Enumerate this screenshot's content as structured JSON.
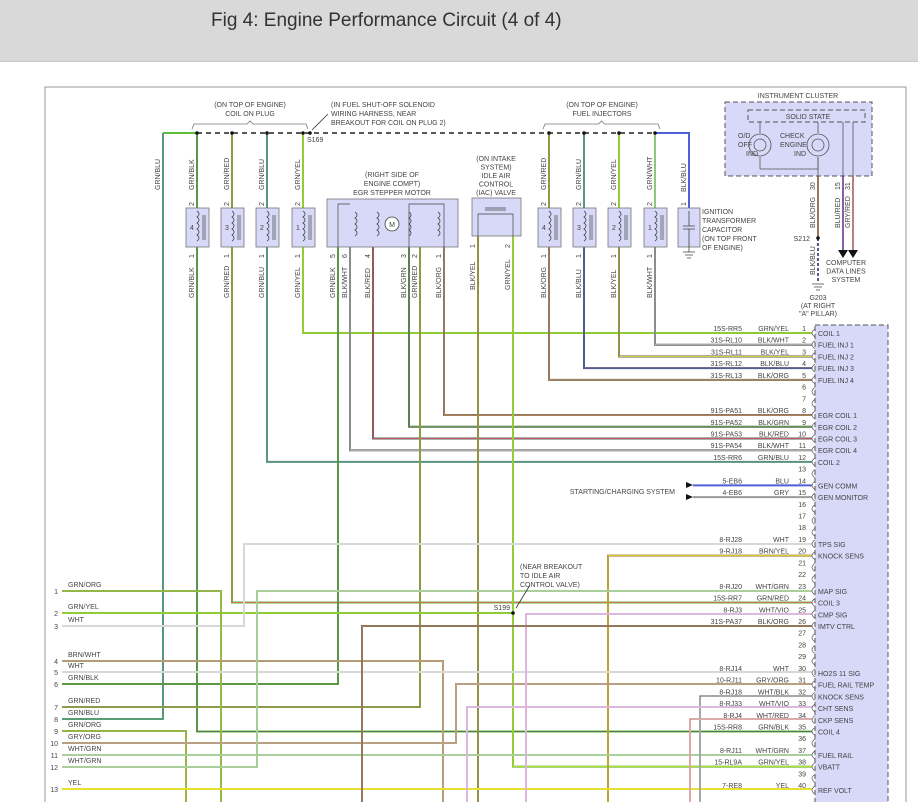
{
  "header": {
    "title": "Fig 4: Engine Performance Circuit (4 of 4)"
  },
  "wire_colors": {
    "GRN": "#5cbf3a",
    "BLK": "#5a5a5a",
    "RED": "#e06060",
    "BLU": "#5060d8",
    "YEL": "#e8e030",
    "WHT": "#d8d8d8",
    "ORG": "#f0a860",
    "GRY": "#9a9a9a",
    "BRN": "#a07838",
    "VIO": "#e880e8"
  },
  "box_fill": "#d8d8f8",
  "labels": {
    "coil_on_plug": [
      "(ON TOP OF ENGINE)",
      "COIL ON PLUG"
    ],
    "s169_note": [
      "(IN FUEL SHUT-OFF SOLENOID",
      "WIRING HARNESS, NEAR",
      "BREAKOUT FOR COIL ON PLUG 2)"
    ],
    "s169": "S169",
    "fuel_injectors": [
      "(ON TOP OF ENGINE)",
      "FUEL INJECTORS"
    ],
    "egr": [
      "(RIGHT SIDE OF",
      "ENGINE COMPT)",
      "EGR STEPPER MOTOR"
    ],
    "iac": [
      "(ON INTAKE",
      "SYSTEM)",
      "IDLE AIR",
      "CONTROL",
      "(IAC) VALVE"
    ],
    "capacitor": [
      "IGNITION",
      "TRANSFORMER",
      "CAPACITOR",
      "(ON TOP FRONT",
      "OF ENGINE)"
    ],
    "instrument_cluster": "INSTRUMENT CLUSTER",
    "solid_state": "SOLID STATE",
    "od_off": [
      "O/D",
      "OFF",
      "IND"
    ],
    "check_engine": [
      "CHECK",
      "ENGINE",
      "IND"
    ],
    "motor": "M",
    "s212": "S212",
    "g203": [
      "G203",
      "(AT RIGHT",
      "\"A\" PILLAR)"
    ],
    "data_lines": [
      "COMPUTER",
      "DATA LINES",
      "SYSTEM"
    ],
    "starting_charging": "STARTING/CHARGING SYSTEM",
    "s199_note": [
      "(NEAR BREAKOUT",
      "TO IDLE AIR",
      "CONTROL VALVE)"
    ],
    "s199": "S199"
  },
  "coils": [
    {
      "num": "4",
      "top_pin": "2",
      "top_color": "GRN/BLK",
      "bot_pin": "1",
      "bot_color": "GRN/BLK"
    },
    {
      "num": "3",
      "top_pin": "2",
      "top_color": "GRN/RED",
      "bot_pin": "1",
      "bot_color": "GRN/RED"
    },
    {
      "num": "2",
      "top_pin": "2",
      "top_color": "GRN/BLU",
      "bot_pin": "1",
      "bot_color": "GRN/BLU"
    },
    {
      "num": "1",
      "top_pin": "2",
      "top_color": "GRN/YEL",
      "bot_pin": "1",
      "bot_color": "GRN/YEL"
    }
  ],
  "injectors": [
    {
      "num": "4",
      "top_pin": "2",
      "top_color": "GRN/RED",
      "bot_pin": "1",
      "bot_color": "BLK/ORG"
    },
    {
      "num": "3",
      "top_pin": "2",
      "top_color": "GRN/BLU",
      "bot_pin": "1",
      "bot_color": "BLK/BLU"
    },
    {
      "num": "2",
      "top_pin": "2",
      "top_color": "GRN/YEL",
      "bot_pin": "1",
      "bot_color": "BLK/YEL"
    },
    {
      "num": "1",
      "top_pin": "2",
      "top_color": "GRN/WHT",
      "bot_pin": "1",
      "bot_color": "BLK/WHT"
    }
  ],
  "capacitor_wire": {
    "pin": "1",
    "color": "BLK/BLU"
  },
  "left_bus_wire": "GRN/BLU",
  "egr_pins": [
    {
      "pin": "5",
      "color": "GRN/BLK"
    },
    {
      "pin": "6",
      "color": "BLK/WHT"
    },
    {
      "pin": "4",
      "color": "BLK/RED"
    },
    {
      "pin": "3",
      "color": "BLK/GRN"
    },
    {
      "pin": "2",
      "color": "GRN/RED"
    },
    {
      "pin": "1",
      "color": "BLK/ORG"
    }
  ],
  "iac_pins": [
    {
      "pin": "1",
      "color": "BLK/YEL"
    },
    {
      "pin": "2",
      "color": "GRN/YEL"
    }
  ],
  "cluster_pins": [
    {
      "pin": "30",
      "color": "BLK/ORG"
    },
    {
      "pin": "15",
      "color": "BLU/RED"
    },
    {
      "pin": "31",
      "color": "GRY/RED"
    }
  ],
  "ground_wire": "BLK/BLU",
  "pcm_pins": [
    {
      "pin": "1",
      "circuit": "15S-RR5",
      "color": "GRN/YEL",
      "name": "COIL 1"
    },
    {
      "pin": "2",
      "circuit": "31S-RL10",
      "color": "BLK/WHT",
      "name": "FUEL INJ 1"
    },
    {
      "pin": "3",
      "circuit": "31S-RL11",
      "color": "BLK/YEL",
      "name": "FUEL INJ 2"
    },
    {
      "pin": "4",
      "circuit": "31S-RL12",
      "color": "BLK/BLU",
      "name": "FUEL INJ 3"
    },
    {
      "pin": "5",
      "circuit": "31S-RL13",
      "color": "BLK/ORG",
      "name": "FUEL INJ 4"
    },
    {
      "pin": "6",
      "circuit": "",
      "color": "",
      "name": ""
    },
    {
      "pin": "7",
      "circuit": "",
      "color": "",
      "name": ""
    },
    {
      "pin": "8",
      "circuit": "91S-PA51",
      "color": "BLK/ORG",
      "name": "EGR COIL 1"
    },
    {
      "pin": "9",
      "circuit": "91S-PA52",
      "color": "BLK/GRN",
      "name": "EGR COIL 2"
    },
    {
      "pin": "10",
      "circuit": "91S-PA53",
      "color": "BLK/RED",
      "name": "EGR COIL 3"
    },
    {
      "pin": "11",
      "circuit": "91S-PA54",
      "color": "BLK/WHT",
      "name": "EGR COIL 4"
    },
    {
      "pin": "12",
      "circuit": "15S-RR6",
      "color": "GRN/BLU",
      "name": "COIL 2"
    },
    {
      "pin": "13",
      "circuit": "",
      "color": "",
      "name": ""
    },
    {
      "pin": "14",
      "circuit": "5-EB6",
      "color": "BLU",
      "name": "GEN COMM"
    },
    {
      "pin": "15",
      "circuit": "4-EB6",
      "color": "GRY",
      "name": "GEN MONITOR"
    },
    {
      "pin": "16",
      "circuit": "",
      "color": "",
      "name": ""
    },
    {
      "pin": "17",
      "circuit": "",
      "color": "",
      "name": ""
    },
    {
      "pin": "18",
      "circuit": "",
      "color": "",
      "name": ""
    },
    {
      "pin": "19",
      "circuit": "8-RJ28",
      "color": "WHT",
      "name": "TPS SIG"
    },
    {
      "pin": "20",
      "circuit": "9-RJ18",
      "color": "BRN/YEL",
      "name": "KNOCK SENS"
    },
    {
      "pin": "21",
      "circuit": "",
      "color": "",
      "name": ""
    },
    {
      "pin": "22",
      "circuit": "",
      "color": "",
      "name": ""
    },
    {
      "pin": "23",
      "circuit": "8-RJ20",
      "color": "WHT/GRN",
      "name": "MAP SIG"
    },
    {
      "pin": "24",
      "circuit": "15S-RR7",
      "color": "GRN/RED",
      "name": "COIL 3"
    },
    {
      "pin": "25",
      "circuit": "8-RJ3",
      "color": "WHT/VIO",
      "name": "CMP SIG"
    },
    {
      "pin": "26",
      "circuit": "31S-PA37",
      "color": "BLK/ORG",
      "name": "IMTV CTRL"
    },
    {
      "pin": "27",
      "circuit": "",
      "color": "",
      "name": ""
    },
    {
      "pin": "28",
      "circuit": "",
      "color": "",
      "name": ""
    },
    {
      "pin": "29",
      "circuit": "",
      "color": "",
      "name": ""
    },
    {
      "pin": "30",
      "circuit": "8-RJ14",
      "color": "WHT",
      "name": "HO2S 11 SIG"
    },
    {
      "pin": "31",
      "circuit": "10-RJ11",
      "color": "GRY/ORG",
      "name": "FUEL RAIL TEMP"
    },
    {
      "pin": "32",
      "circuit": "8-RJ18",
      "color": "WHT/BLK",
      "name": "KNOCK SENS"
    },
    {
      "pin": "33",
      "circuit": "8-RJ33",
      "color": "WHT/VIO",
      "name": "CHT SENS"
    },
    {
      "pin": "34",
      "circuit": "8-RJ4",
      "color": "WHT/RED",
      "name": "CKP SENS"
    },
    {
      "pin": "35",
      "circuit": "15S-RR8",
      "color": "GRN/BLK",
      "name": "COIL 4"
    },
    {
      "pin": "36",
      "circuit": "",
      "color": "",
      "name": ""
    },
    {
      "pin": "37",
      "circuit": "8-RJ11",
      "color": "WHT/GRN",
      "name": "FUEL RAIL"
    },
    {
      "pin": "38",
      "circuit": "15-RL9A",
      "color": "GRN/YEL",
      "name": "VBATT"
    },
    {
      "pin": "39",
      "circuit": "",
      "color": "",
      "name": ""
    },
    {
      "pin": "40",
      "circuit": "7-RE8",
      "color": "YEL",
      "name": "REF VOLT"
    }
  ],
  "left_connector": [
    {
      "pin": "1",
      "color": "GRN/ORG"
    },
    {
      "pin": "2",
      "color": "GRN/YEL"
    },
    {
      "pin": "3",
      "color": "WHT"
    },
    {
      "pin": "4",
      "color": "BRN/WHT"
    },
    {
      "pin": "5",
      "color": "WHT"
    },
    {
      "pin": "6",
      "color": "GRN/BLK"
    },
    {
      "pin": "7",
      "color": "GRN/RED"
    },
    {
      "pin": "8",
      "color": "GRN/BLU"
    },
    {
      "pin": "9",
      "color": "GRN/ORG"
    },
    {
      "pin": "10",
      "color": "GRY/ORG"
    },
    {
      "pin": "11",
      "color": "WHT/GRN"
    },
    {
      "pin": "12",
      "color": "WHT/GRN"
    },
    {
      "pin": "13",
      "color": "YEL"
    }
  ]
}
